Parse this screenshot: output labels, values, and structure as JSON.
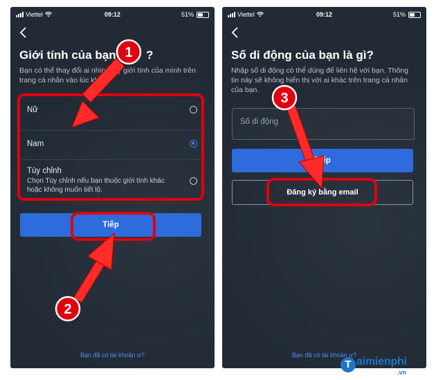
{
  "status": {
    "carrier": "Viettel",
    "time": "09:12",
    "battery": "51%"
  },
  "screen_gender": {
    "title": "Giới tính của bạn là gì?",
    "title_visible": "Giới tính của bạn l",
    "title_suffix": "?",
    "description": "Bạn có thể thay đổi ai nhìn thấy giới tính của mình trên trang cá nhân vào lúc khác.",
    "options": [
      {
        "label": "Nữ",
        "selected": false
      },
      {
        "label": "Nam",
        "selected": true
      },
      {
        "label": "Tùy chỉnh",
        "sublabel": "Chọn Tùy chỉnh nếu bạn thuộc giới tính khác hoặc không muốn tiết lộ.",
        "selected": false
      }
    ],
    "next_label": "Tiếp",
    "footer_link": "Bạn đã có tài khoản ư?"
  },
  "screen_phone": {
    "title": "Số di động của bạn là gì?",
    "description": "Nhập số di động có thể dùng để liên hệ với bạn. Thông tin này sẽ không hiển thị với ai khác trên trang cá nhân của bạn.",
    "input_placeholder": "Số di động",
    "next_label": "Tiếp",
    "email_button_label": "Đăng ký bằng email",
    "footer_link": "Bạn đã có tài khoản ư?"
  },
  "annotations": {
    "step1": "1",
    "step2": "2",
    "step3": "3",
    "highlight_color": "#e1000f"
  },
  "watermark": {
    "brand": "aimienphi",
    "letter": "T",
    "suffix": ".vn"
  },
  "colors": {
    "background": "#222b35",
    "primary": "#2e6bdc",
    "link": "#4f8ef5",
    "radio_selected": "#3b82f6"
  }
}
